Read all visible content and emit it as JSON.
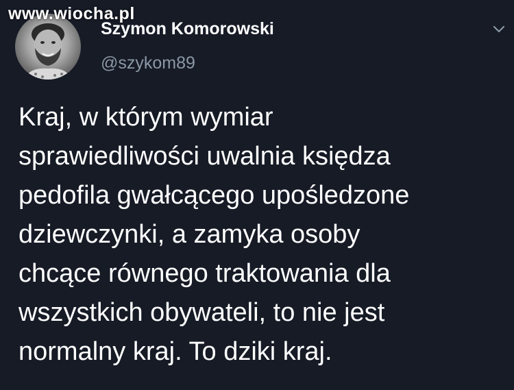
{
  "watermark": "www.wiocha.pl",
  "author": {
    "display_name": "Szymon Komorowski",
    "handle": "@szykom89"
  },
  "icons": {
    "avatar": "profile-photo",
    "menu": "chevron-down-icon"
  },
  "tweet": {
    "lines": [
      "Kraj, w którym wymiar",
      "sprawiedliwości uwalnia księdza",
      "pedofila gwałcącego upośledzone",
      "dziewczynki, a zamyka osoby",
      "chcące równego traktowania dla",
      "wszystkich obywateli, to nie jest",
      "normalny kraj. To dziki kraj."
    ]
  },
  "colors": {
    "background": "#161b26",
    "text": "#ffffff",
    "handle": "#8b98a5"
  }
}
